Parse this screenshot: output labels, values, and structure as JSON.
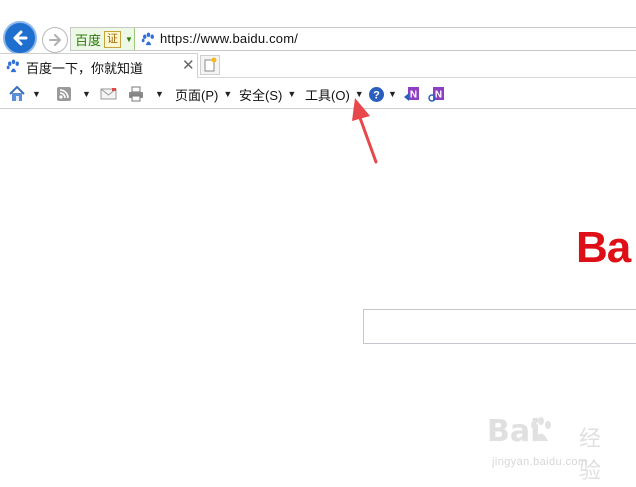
{
  "address_bar": {
    "site_name": "百度",
    "cert_badge": "证",
    "url": "https://www.baidu.com/"
  },
  "tab": {
    "title": "百度一下，你就知道",
    "close_glyph": "✕"
  },
  "command_bar": {
    "page_menu": "页面(P)",
    "safety_menu": "安全(S)",
    "tools_menu": "工具(O)",
    "icons": [
      "home-icon",
      "rss-feed-icon",
      "mail-icon",
      "print-icon",
      "help-icon",
      "onenote-send-icon",
      "onenote-linked-icon"
    ]
  },
  "page": {
    "logo_text": "Ba"
  },
  "watermark": {
    "logo": "Bai",
    "chinese": "经验",
    "url": "jingyan.baidu.com"
  },
  "colors": {
    "baidu_red": "#de0f17",
    "ie_blue": "#1e6fce",
    "annotation_arrow": "#e8484b"
  }
}
